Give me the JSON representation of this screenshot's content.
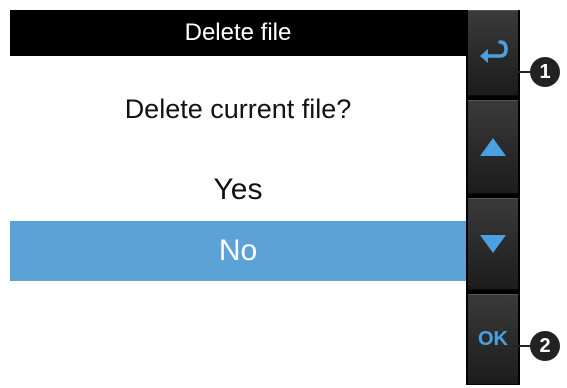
{
  "title": "Delete file",
  "question": "Delete current file?",
  "options": [
    {
      "label": "Yes",
      "selected": false
    },
    {
      "label": "No",
      "selected": true
    }
  ],
  "side_buttons": {
    "back_icon": "return-arrow-icon",
    "up_icon": "triangle-up-icon",
    "down_icon": "triangle-down-icon",
    "ok_label": "OK"
  },
  "callouts": [
    "1",
    "2"
  ],
  "colors": {
    "accent": "#4aa0e0",
    "selected_bg": "#5ba2d6",
    "title_bg": "#000000"
  }
}
